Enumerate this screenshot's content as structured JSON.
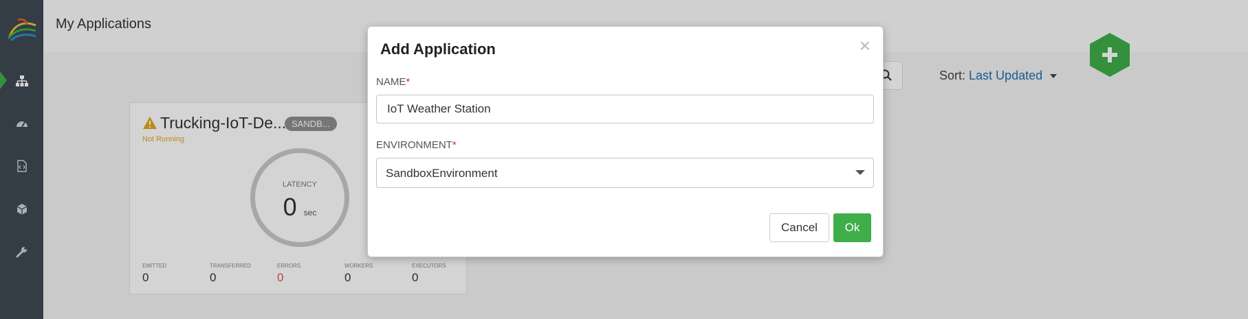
{
  "colors": {
    "sidebar": "#3f4a55",
    "accent_green": "#3fae49",
    "link_blue": "#1f6fb2",
    "required_red": "#d32f2f",
    "warning_yellow": "#e0a81f"
  },
  "header": {
    "title": "My Applications"
  },
  "sidebar": {
    "items": [
      {
        "icon": "sitemap-icon",
        "active": true
      },
      {
        "icon": "dashboard-gauge-icon",
        "active": false
      },
      {
        "icon": "code-file-icon",
        "active": false
      },
      {
        "icon": "cube-icon",
        "active": false
      },
      {
        "icon": "wrench-icon",
        "active": false
      }
    ]
  },
  "toolbar": {
    "search_icon": "search-icon",
    "sort_label": "Sort:",
    "sort_value": "Last Updated",
    "add_icon": "plus-icon"
  },
  "app_card": {
    "name": "Trucking-IoT-De...",
    "environment": "SANDB...",
    "status": "Not Running",
    "latency_label": "LATENCY",
    "latency_value": "0",
    "latency_unit": "sec",
    "metrics": [
      {
        "label": "EMITTED",
        "value": "0"
      },
      {
        "label": "TRANSFERRED",
        "value": "0"
      },
      {
        "label": "ERRORS",
        "value": "0"
      },
      {
        "label": "WORKERS",
        "value": "0"
      },
      {
        "label": "EXECUTORS",
        "value": "0"
      }
    ]
  },
  "modal": {
    "title": "Add Application",
    "close_symbol": "×",
    "name_label": "NAME",
    "name_value": "IoT Weather Station",
    "environment_label": "ENVIRONMENT",
    "environment_value": "SandboxEnvironment",
    "required_mark": "*",
    "cancel_label": "Cancel",
    "ok_label": "Ok"
  }
}
